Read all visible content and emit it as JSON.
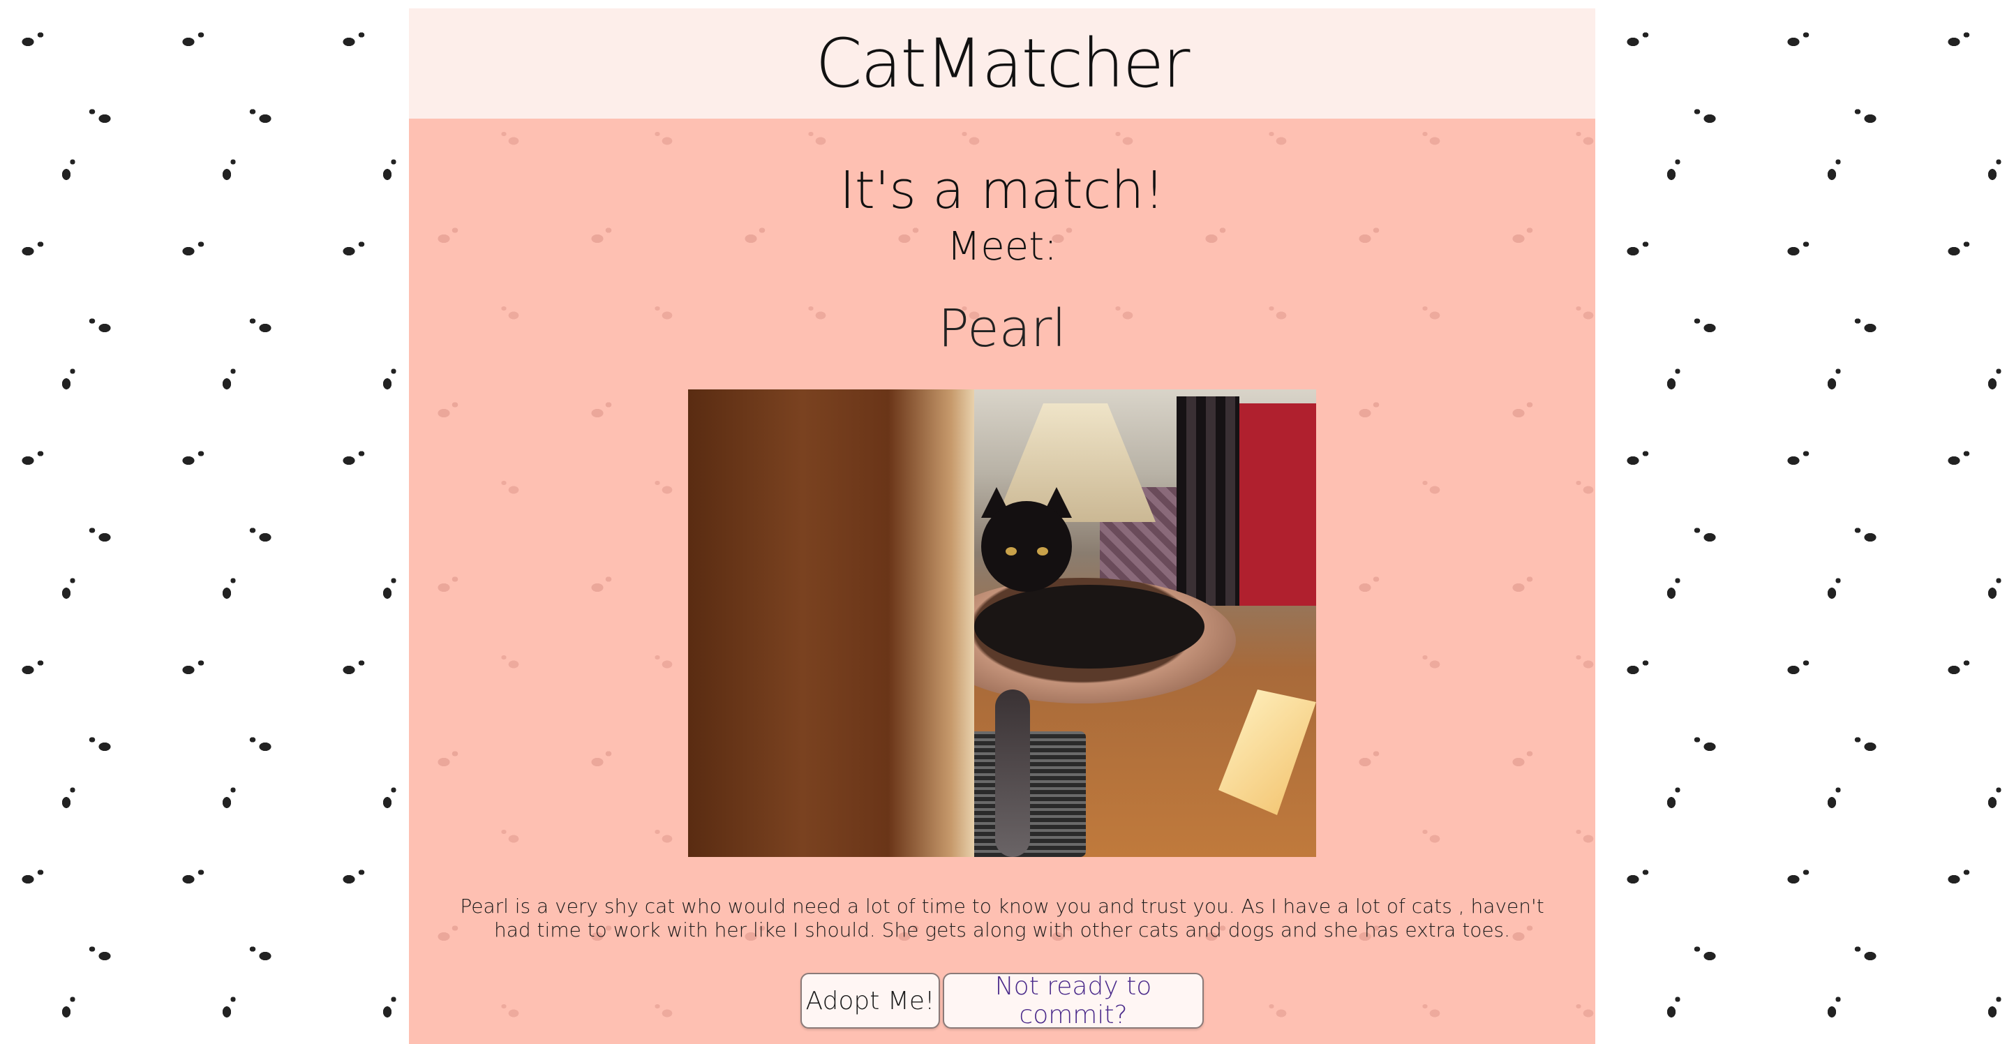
{
  "app": {
    "title": "CatMatcher"
  },
  "match": {
    "heading": "It's a match!",
    "meet_label": "Meet:",
    "cat_name": "Pearl",
    "photo_alt": "Pearl",
    "description": "Pearl is a very shy cat who would need a lot of time to know you and trust you. As I have a lot of cats , haven't had time to work with her like I should. She gets along with other cats and dogs and she has extra toes."
  },
  "actions": {
    "adopt_label": "Adopt Me!",
    "not_ready_label": "Not ready to commit?"
  },
  "colors": {
    "panel_background": "#fec0b2",
    "header_background": "#fdeeea",
    "secondary_link": "#4a2a8a"
  }
}
